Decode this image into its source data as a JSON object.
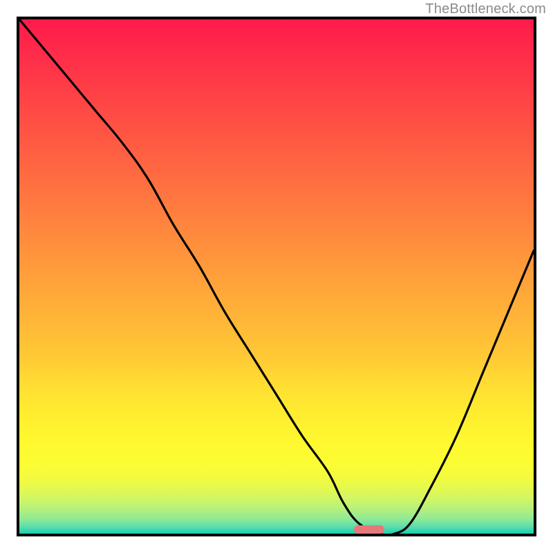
{
  "attribution": "TheBottleneck.com",
  "chart_data": {
    "type": "line",
    "title": "",
    "xlabel": "",
    "ylabel": "",
    "xlim": [
      0,
      100
    ],
    "ylim": [
      0,
      100
    ],
    "grid": false,
    "series": [
      {
        "name": "bottleneck-curve",
        "x": [
          0,
          5,
          10,
          15,
          20,
          25,
          30,
          35,
          40,
          45,
          50,
          55,
          60,
          63,
          66,
          70,
          73,
          76,
          80,
          85,
          90,
          95,
          100
        ],
        "y": [
          100,
          94,
          88,
          82,
          76,
          69,
          60,
          52,
          43,
          35,
          27,
          19,
          12,
          6,
          2,
          0,
          0,
          2,
          9,
          19,
          31,
          43,
          55
        ]
      }
    ],
    "annotations": [
      {
        "name": "optimal-marker",
        "shape": "pill",
        "x_center": 68,
        "y_center": 0.8,
        "width_pct": 6,
        "height_pct": 1.6,
        "color": "#e77878"
      }
    ],
    "background": {
      "type": "vertical-gradient",
      "note": "red (top) through orange, yellow, green (bottom)"
    }
  }
}
